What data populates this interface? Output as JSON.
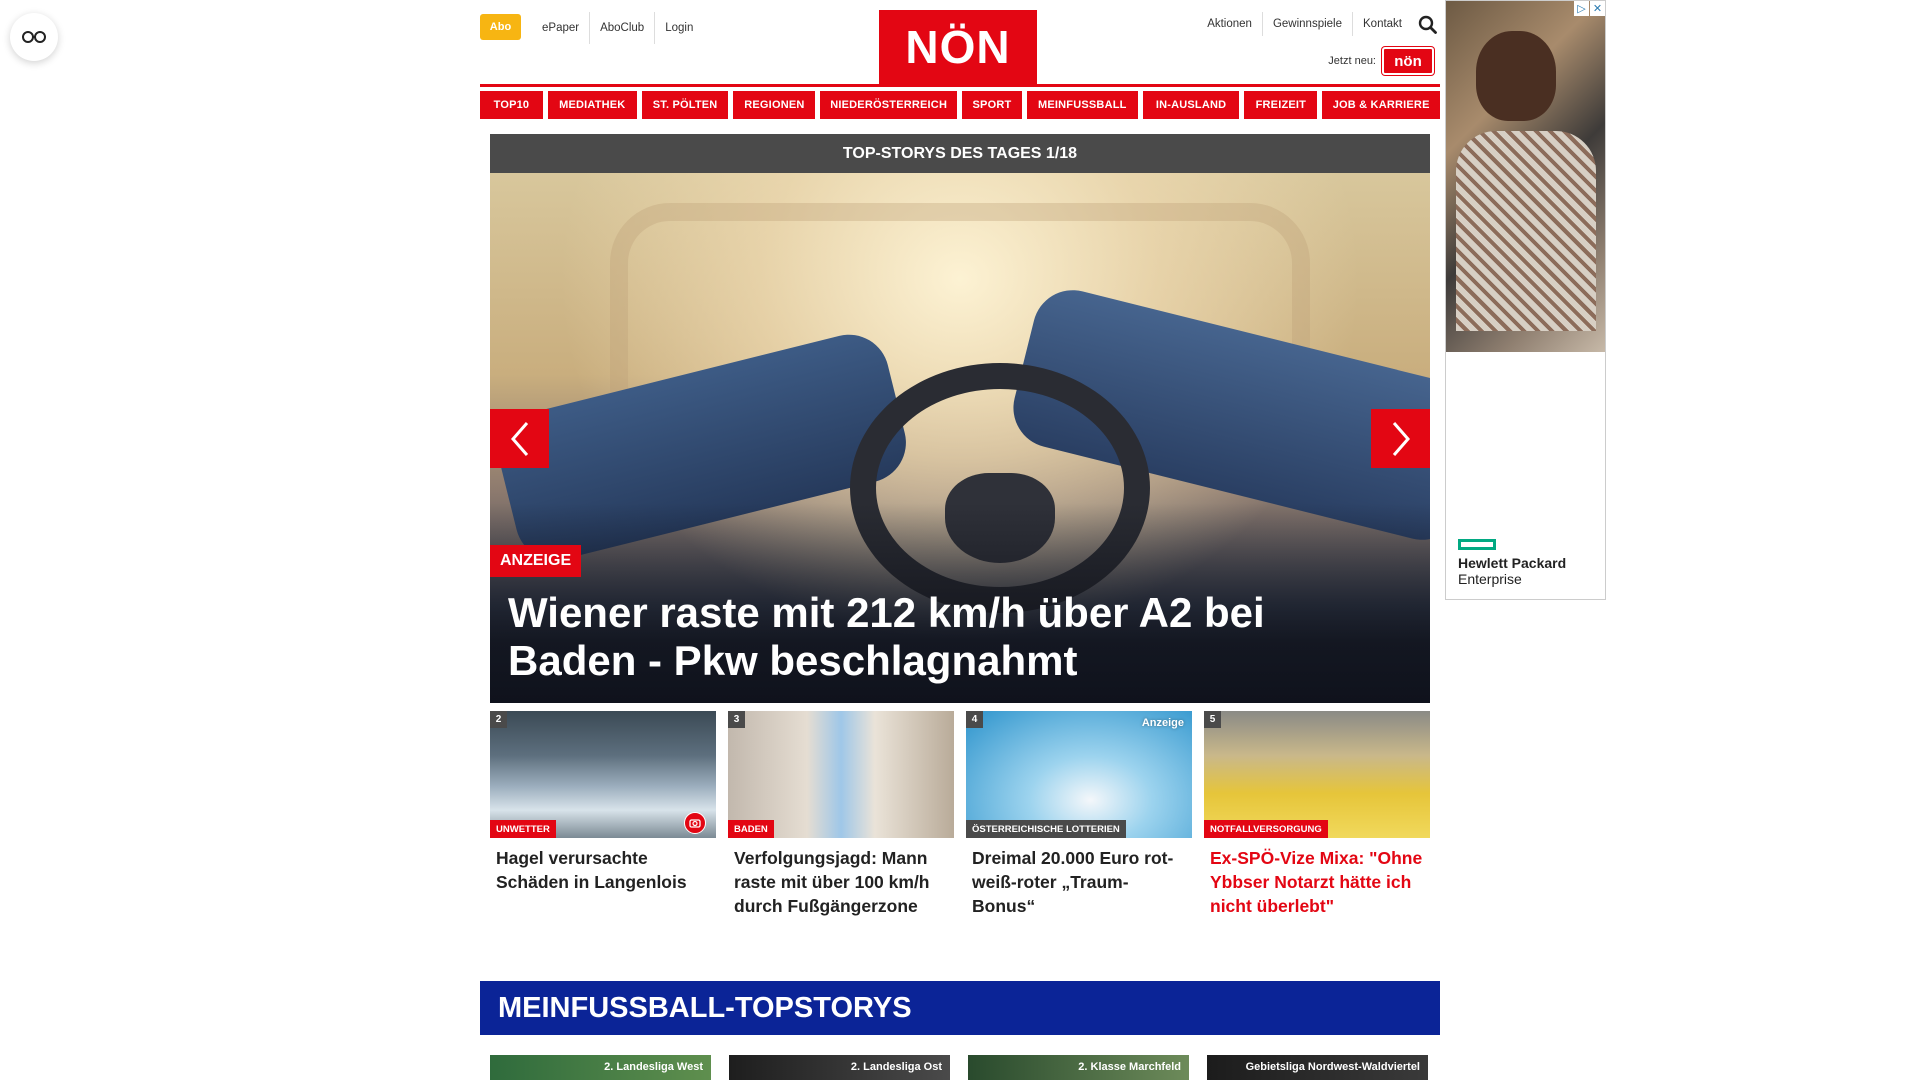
{
  "header": {
    "abo": "Abo",
    "top_links": [
      "ePaper",
      "AboClub",
      "Login"
    ],
    "logo": "NÖN",
    "right_links": [
      "Aktionen",
      "Gewinnspiele",
      "Kontakt"
    ],
    "jetzt_neu": "Jetzt neu:",
    "mini_logo": "nön"
  },
  "nav": {
    "items": [
      {
        "label": "TOP10",
        "w": 63
      },
      {
        "label": "MEDIATHEK",
        "w": 89
      },
      {
        "label": "ST. PÖLTEN",
        "w": 87
      },
      {
        "label": "REGIONEN",
        "w": 82
      },
      {
        "label": "NIEDERÖSTERREICH",
        "w": 137
      },
      {
        "label": "SPORT",
        "w": 60
      },
      {
        "label": "MEINFUSSBALL",
        "w": 111
      },
      {
        "label": "IN-AUSLAND",
        "w": 97
      },
      {
        "label": "FREIZEIT",
        "w": 73
      },
      {
        "label": "JOB & KARRIERE",
        "w": 118
      }
    ]
  },
  "hero": {
    "bar_title": "TOP-STORYS DES TAGES 1/18",
    "badge": "ANZEIGE",
    "title": "Wiener raste mit 212 km/h über A2 bei Baden - Pkw beschlagnahmt"
  },
  "stories": [
    {
      "num": "2",
      "category": "UNWETTER",
      "title": "Hagel verursachte Schäden in Langenlois",
      "highlight": false
    },
    {
      "num": "3",
      "category": "BADEN",
      "title": "Verfolgungsjagd: Mann raste mit über 100 km/h durch Fußgängerzone",
      "highlight": false
    },
    {
      "num": "4",
      "category": "ÖSTERREICHISCHE LOTTERIEN",
      "badge": "Anzeige",
      "title": "Dreimal 20.000 Euro rot-weiß-roter „Traum-Bonus“",
      "highlight": false
    },
    {
      "num": "5",
      "category": "NOTFALLVERSORGUNG",
      "title": "Ex-SPÖ-Vize Mixa: \"Ohne Ybbser Notarzt hätte ich nicht überlebt\"",
      "highlight": true
    }
  ],
  "section": {
    "title": "MEINFUSSBALL-TOPSTORYS",
    "cards": [
      "2. Landesliga West",
      "2. Landesliga Ost",
      "2. Klasse Marchfeld",
      "Gebietsliga Nordwest-Waldviertel"
    ]
  },
  "ad": {
    "brand_line1": "Hewlett Packard",
    "brand_line2": "Enterprise"
  },
  "colors": {
    "brand_red": "#e30613",
    "abo_yellow": "#f7b512",
    "section_blue": "#0b2497",
    "bar_gray": "#4a4a4a",
    "hpe_green": "#01a982"
  },
  "icons": [
    "glasses-icon",
    "search-icon",
    "arrow-left-icon",
    "arrow-right-icon",
    "camera-icon",
    "adchoices-icon",
    "close-icon"
  ]
}
